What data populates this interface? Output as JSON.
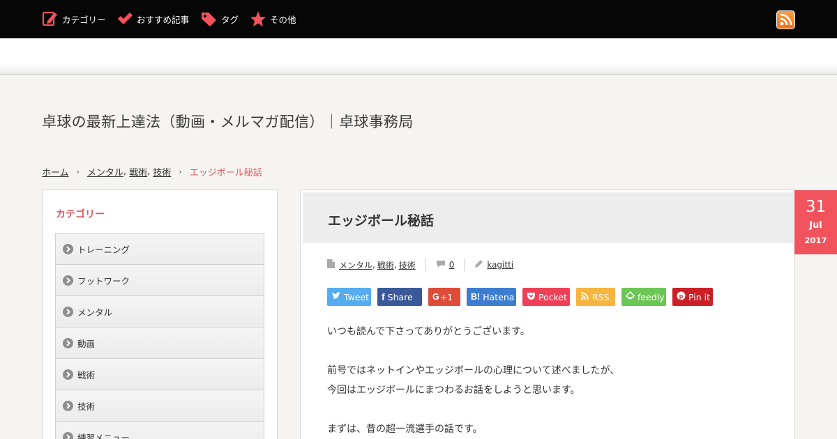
{
  "nav": {
    "items": [
      {
        "label": "カテゴリー",
        "icon": "pencil-note-icon"
      },
      {
        "label": "おすすめ記事",
        "icon": "checkmark-icon"
      },
      {
        "label": "タグ",
        "icon": "tag-icon"
      },
      {
        "label": "その他",
        "icon": "star-icon"
      }
    ],
    "accent": "#f0535c",
    "rss_icon": "rss-feed-icon"
  },
  "site": {
    "title": "卓球の最新上達法（動画・メルマガ配信）｜卓球事務局"
  },
  "breadcrumb": {
    "home": "ホーム",
    "categories": [
      "メンタル",
      "戦術",
      "技術"
    ],
    "current": "エッジボール秘話"
  },
  "sidebar": {
    "heading": "カテゴリー",
    "items": [
      "トレーニング",
      "フットワーク",
      "メンタル",
      "動画",
      "戦術",
      "技術",
      "練習メニュー"
    ]
  },
  "article": {
    "title": "エッジボール秘話",
    "date": {
      "day": "31",
      "month": "Jul",
      "year": "2017"
    },
    "meta": {
      "categories": [
        "メンタル",
        "戦術",
        "技術"
      ],
      "comments": "0",
      "author": "kagitti"
    },
    "share": [
      {
        "label": "Tweet",
        "color": "#55acee",
        "icon": "twitter-bird-icon"
      },
      {
        "label": "Share",
        "color": "#3b5998",
        "icon": "facebook-icon"
      },
      {
        "label": "+1",
        "color": "#dd4b39",
        "icon": "google-plus-icon"
      },
      {
        "label": "Hatena",
        "color": "#3c7dd1",
        "icon": "hatena-bookmark-icon"
      },
      {
        "label": "Pocket",
        "color": "#ee4056",
        "icon": "pocket-icon"
      },
      {
        "label": "RSS",
        "color": "#f7b53e",
        "icon": "rss-icon"
      },
      {
        "label": "feedly",
        "color": "#6cc655",
        "icon": "feedly-icon"
      },
      {
        "label": "Pin it",
        "color": "#cb2027",
        "icon": "pinterest-icon"
      }
    ],
    "paragraphs": [
      "いつも読んで下さってありがとうございます。",
      "前号ではネットインやエッジボールの心理について述べましたが、",
      "今回はエッジボールにまつわるお話をしようと思います。",
      "まずは、昔の超一流選手の話です。"
    ]
  }
}
